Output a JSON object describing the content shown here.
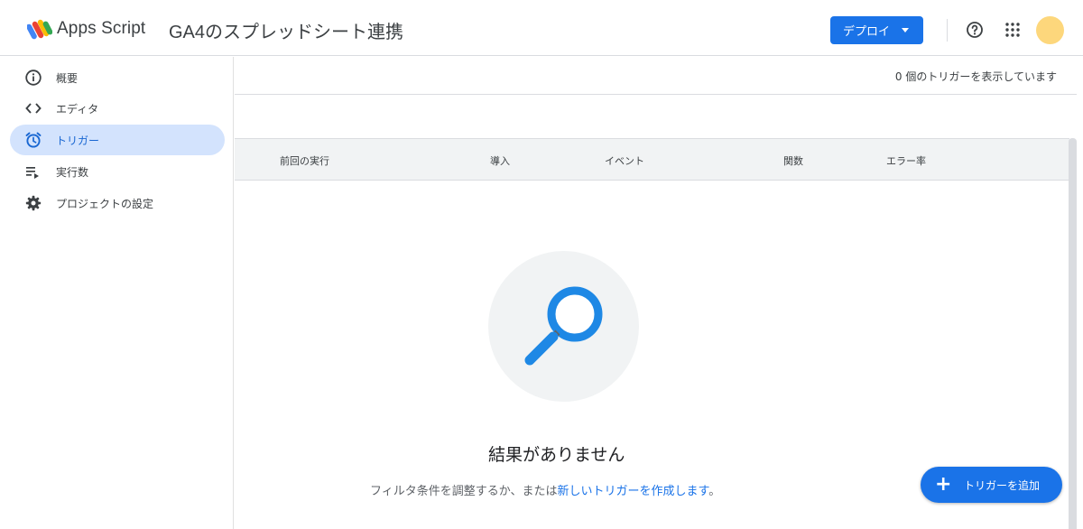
{
  "header": {
    "app_name": "Apps Script",
    "project_title": "GA4のスプレッドシート連携",
    "deploy_label": "デプロイ",
    "avatar_color": "#fdd77c",
    "accent": "#1a73e8"
  },
  "sidebar": {
    "items": [
      {
        "label": "概要",
        "icon": "info-icon"
      },
      {
        "label": "エディタ",
        "icon": "code-icon"
      },
      {
        "label": "トリガー",
        "icon": "alarm-clock-icon",
        "active": true
      },
      {
        "label": "実行数",
        "icon": "list-play-icon"
      },
      {
        "label": "プロジェクトの設定",
        "icon": "gear-icon"
      }
    ]
  },
  "main": {
    "trigger_count_text": "0 個のトリガーを表示しています",
    "columns": [
      "前回の実行",
      "導入",
      "イベント",
      "関数",
      "エラー率"
    ],
    "empty_title": "結果がありません",
    "empty_sub_prefix": "フィルタ条件を調整するか、または",
    "empty_sub_link": "新しいトリガーを作成します",
    "empty_sub_suffix": "。",
    "fab_label": "トリガーを追加"
  }
}
